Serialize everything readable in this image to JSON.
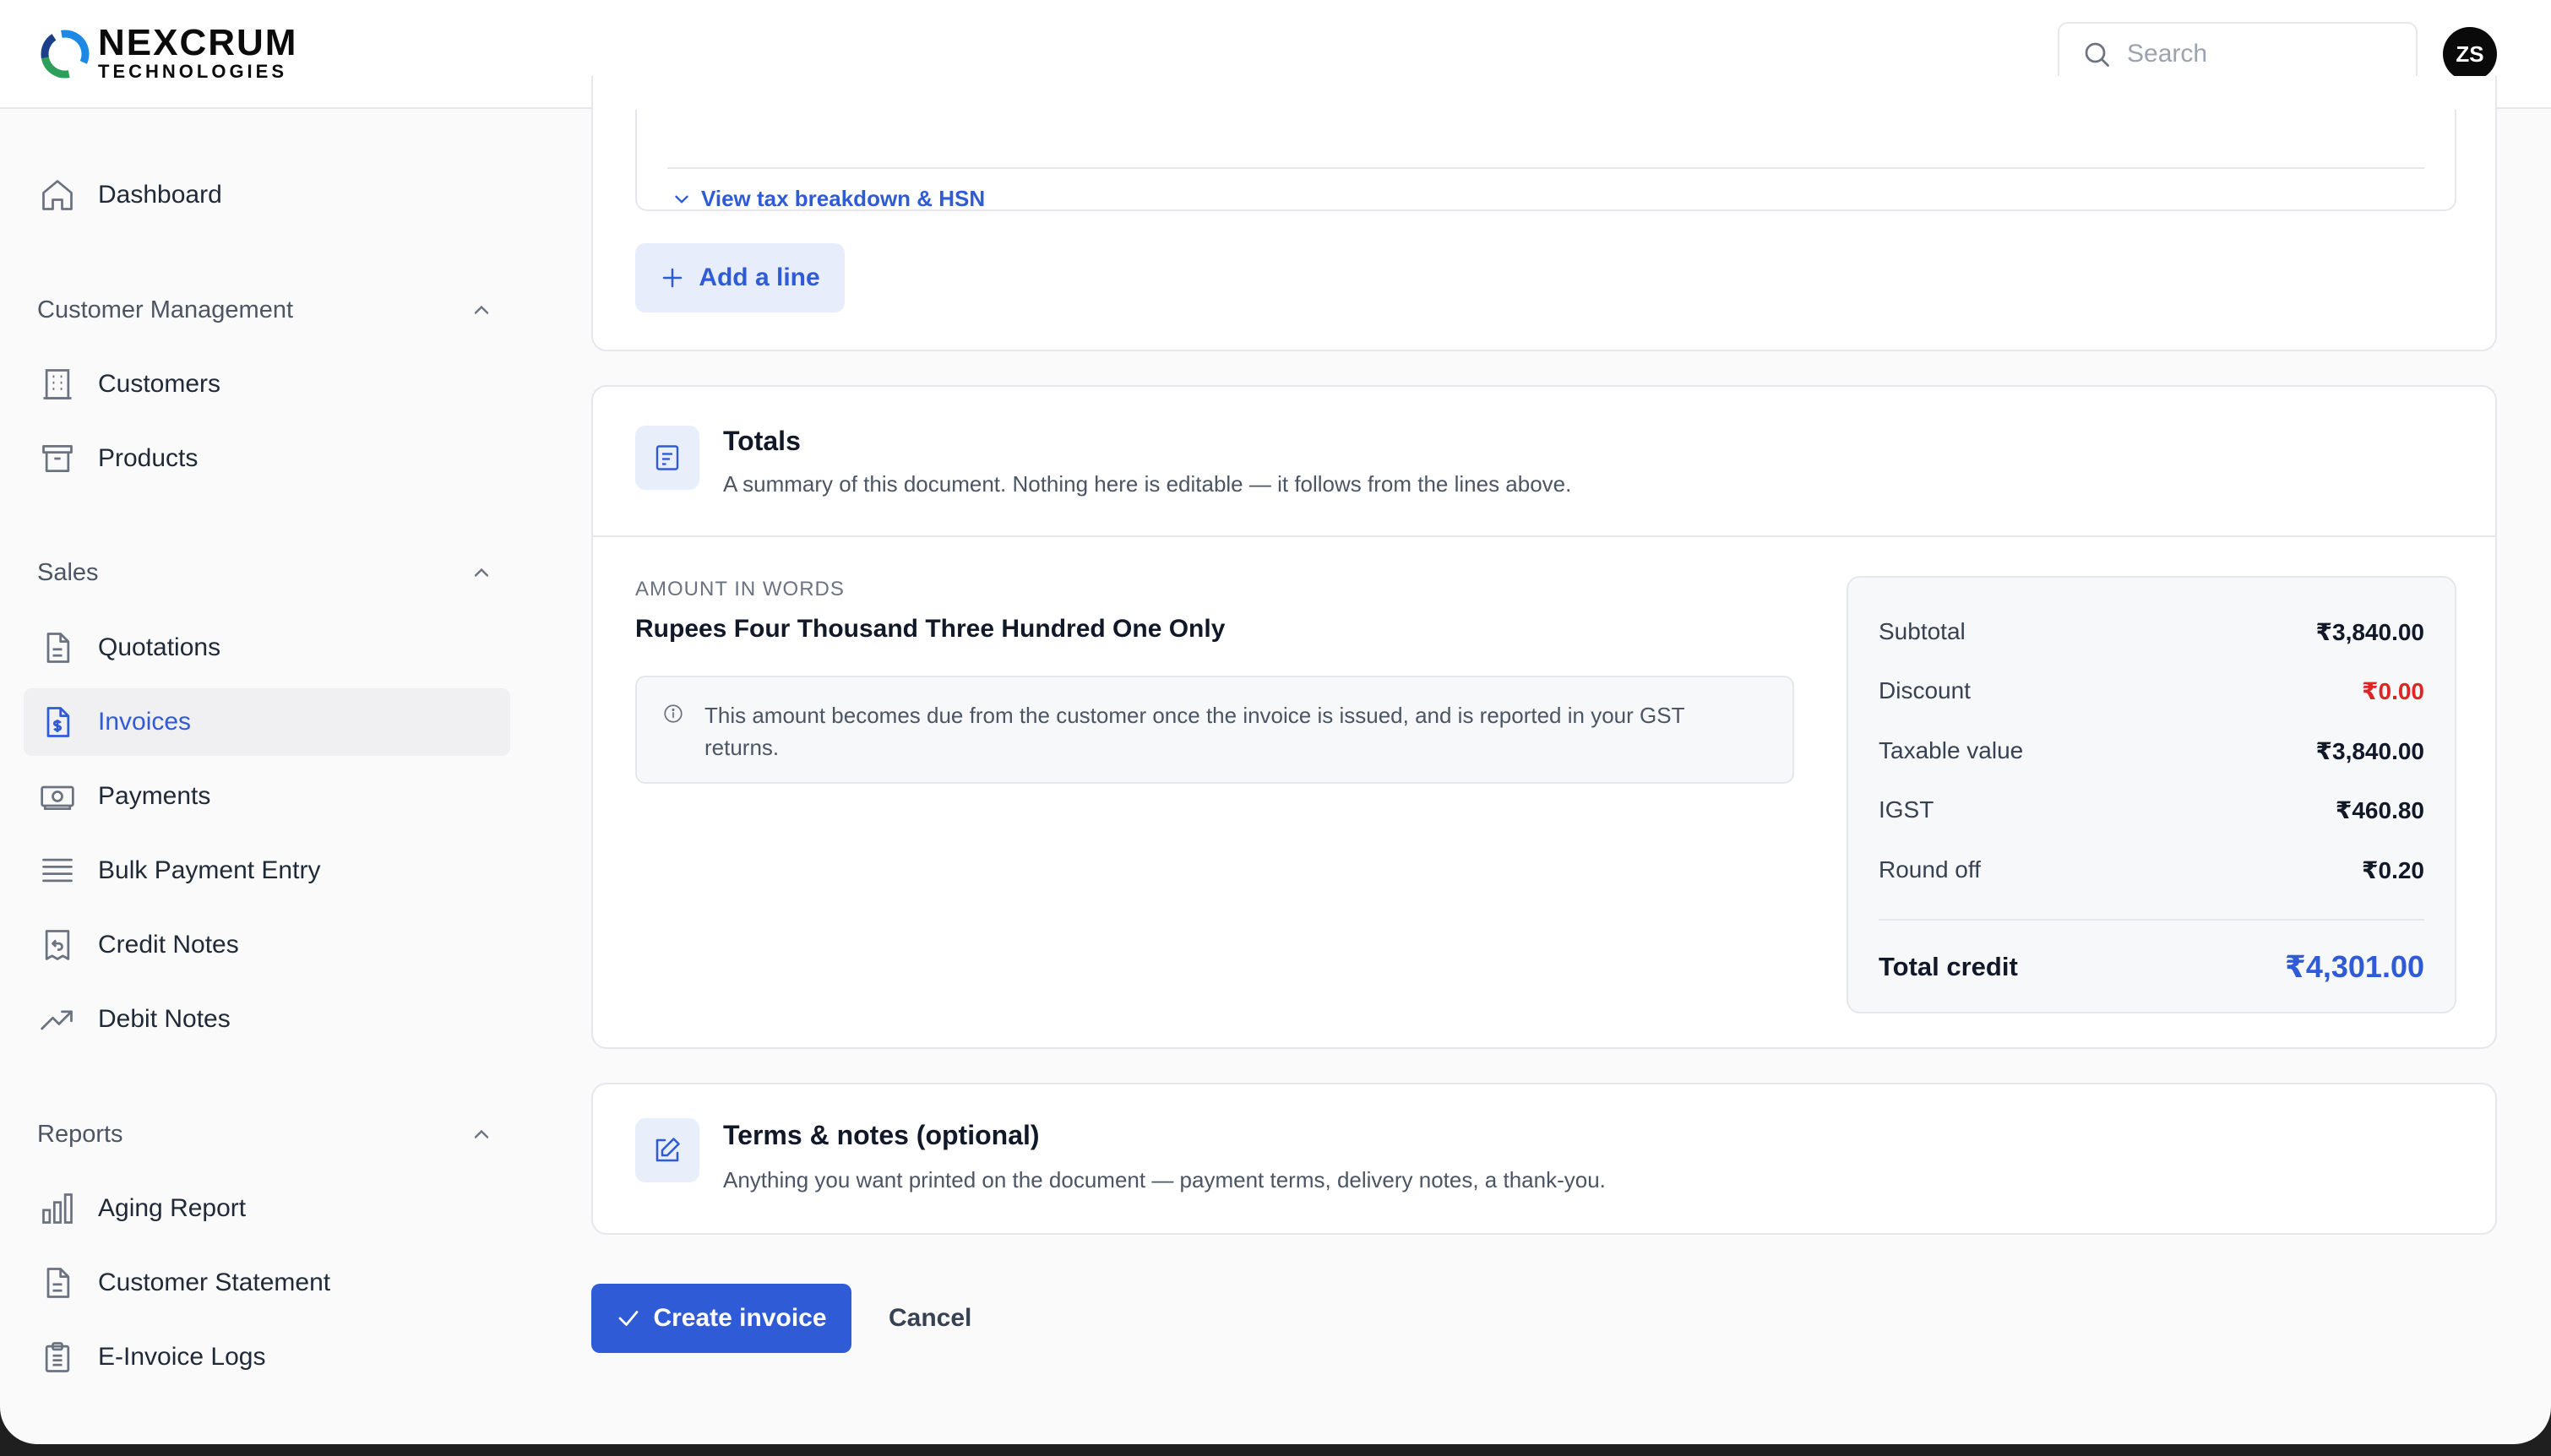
{
  "brand": {
    "name": "NEXCRUM",
    "sub": "TECHNOLOGIES"
  },
  "header": {
    "search_placeholder": "Search",
    "avatar_initials": "ZS"
  },
  "sidebar": {
    "dashboard": "Dashboard",
    "sections": {
      "customer_management": "Customer Management",
      "sales": "Sales",
      "reports": "Reports"
    },
    "items": {
      "customers": "Customers",
      "products": "Products",
      "quotations": "Quotations",
      "invoices": "Invoices",
      "payments": "Payments",
      "bulk_payment_entry": "Bulk Payment Entry",
      "credit_notes": "Credit Notes",
      "debit_notes": "Debit Notes",
      "aging_report": "Aging Report",
      "customer_statement": "Customer Statement",
      "einvoice_logs": "E-Invoice Logs"
    },
    "active": "invoices"
  },
  "lines": {
    "tax_link": "View tax breakdown & HSN",
    "add_line": "Add a line"
  },
  "totals": {
    "title": "Totals",
    "description": "A summary of this document. Nothing here is editable — it follows from the lines above.",
    "amount_in_words_label": "AMOUNT IN WORDS",
    "amount_in_words": "Rupees Four Thousand Three Hundred One Only",
    "notice": "This amount becomes due from the customer once the invoice is issued, and is reported in your GST returns.",
    "rows": {
      "subtotal": {
        "label": "Subtotal",
        "value": "₹3,840.00"
      },
      "discount": {
        "label": "Discount",
        "value": "₹0.00"
      },
      "taxable": {
        "label": "Taxable value",
        "value": "₹3,840.00"
      },
      "igst": {
        "label": "IGST",
        "value": "₹460.80"
      },
      "round_off": {
        "label": "Round off",
        "value": "₹0.20"
      }
    },
    "total": {
      "label": "Total credit",
      "value": "₹4,301.00"
    }
  },
  "terms": {
    "title": "Terms & notes (optional)",
    "description": "Anything you want printed on the document — payment terms, delivery notes, a thank-you."
  },
  "actions": {
    "create": "Create invoice",
    "cancel": "Cancel"
  },
  "colors": {
    "accent": "#2f5bd6",
    "negative": "#dc2626",
    "icon_bg": "#e9eefb"
  }
}
